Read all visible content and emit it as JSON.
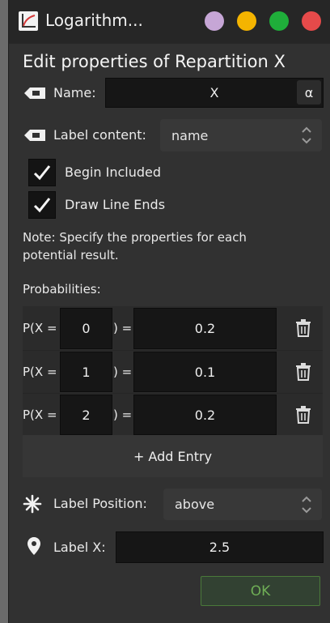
{
  "window": {
    "title": "Logarithm...",
    "controls": {
      "colors": [
        "#c6a6d6",
        "#f4b400",
        "#1fae3a",
        "#e64a4a"
      ]
    }
  },
  "dialog": {
    "heading": "Edit properties of Repartition X",
    "name_label": "Name:",
    "name_value": "X",
    "alpha_button": "α",
    "label_content_label": "Label content:",
    "label_content_value": "name",
    "begin_included_label": "Begin Included",
    "begin_included_checked": true,
    "draw_line_ends_label": "Draw Line Ends",
    "draw_line_ends_checked": true,
    "note": "Note: Specify the properties for each potential result.",
    "probabilities_label": "Probabilities:",
    "entries": [
      {
        "prefix": "P(X =",
        "x": "0",
        "suffix": ") =",
        "p": "0.2"
      },
      {
        "prefix": "P(X =",
        "x": "1",
        "suffix": ") =",
        "p": "0.1"
      },
      {
        "prefix": "P(X =",
        "x": "2",
        "suffix": ") =",
        "p": "0.2"
      }
    ],
    "add_entry_label": "+ Add Entry",
    "label_position_label": "Label Position:",
    "label_position_value": "above",
    "label_x_label": "Label X:",
    "label_x_value": "2.5",
    "ok_label": "OK"
  },
  "icons": {
    "app": "logarithm-app-icon",
    "name": "tag-icon",
    "label_content": "tag-icon",
    "check": "checkmark-icon",
    "delete": "trash-icon",
    "label_position": "asterisk-icon",
    "label_x": "map-pin-icon",
    "select": "up-down-chevron-icon"
  },
  "colors": {
    "background": "#313131",
    "titlebar": "#262626",
    "field": "#161616",
    "ok_text": "#6fae56",
    "ok_border": "#4a7a3a"
  }
}
